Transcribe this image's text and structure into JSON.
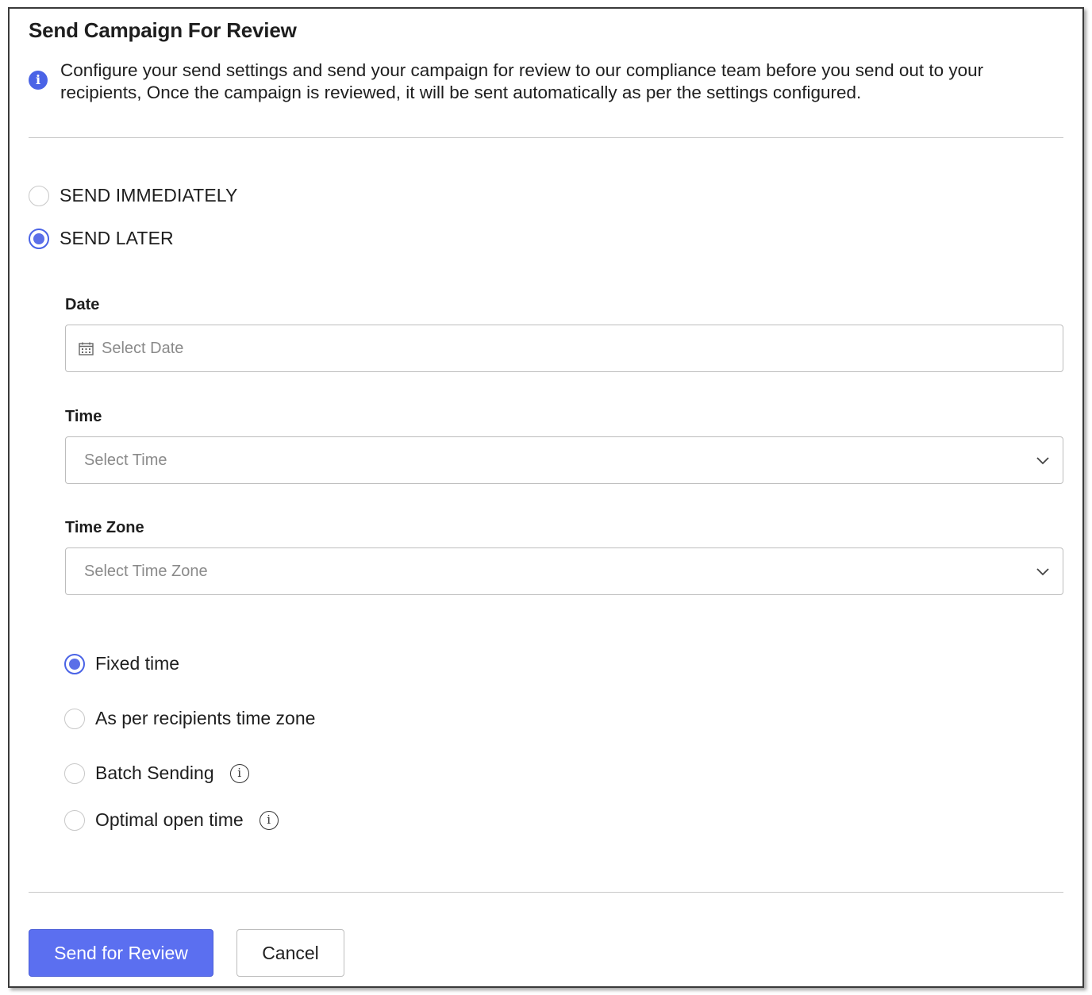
{
  "dialog": {
    "title": "Send Campaign For Review",
    "info_text": "Configure your send settings and send your campaign for review to our compliance team before you send out to your recipients, Once the campaign is reviewed, it will be sent automatically as per the settings configured."
  },
  "send_options": [
    {
      "label": "SEND IMMEDIATELY",
      "checked": false
    },
    {
      "label": "SEND LATER",
      "checked": true
    }
  ],
  "fields": {
    "date": {
      "label": "Date",
      "placeholder": "Select Date"
    },
    "time": {
      "label": "Time",
      "placeholder": "Select Time"
    },
    "timezone": {
      "label": "Time Zone",
      "placeholder": "Select Time Zone"
    }
  },
  "schedule_options": [
    {
      "label": "Fixed time",
      "checked": true
    },
    {
      "label": "As per recipients time zone",
      "checked": false
    },
    {
      "label": "Batch Sending",
      "checked": false
    },
    {
      "label": "Optimal open time",
      "checked": false
    }
  ],
  "buttons": {
    "submit": "Send for Review",
    "cancel": "Cancel"
  },
  "colors": {
    "accent": "#5b6ff0",
    "border": "#bdbdbd",
    "placeholder": "#8a8a8a"
  },
  "icons": {
    "info": "info-icon",
    "calendar": "calendar-icon",
    "dropdown": "chevron-down-icon"
  }
}
